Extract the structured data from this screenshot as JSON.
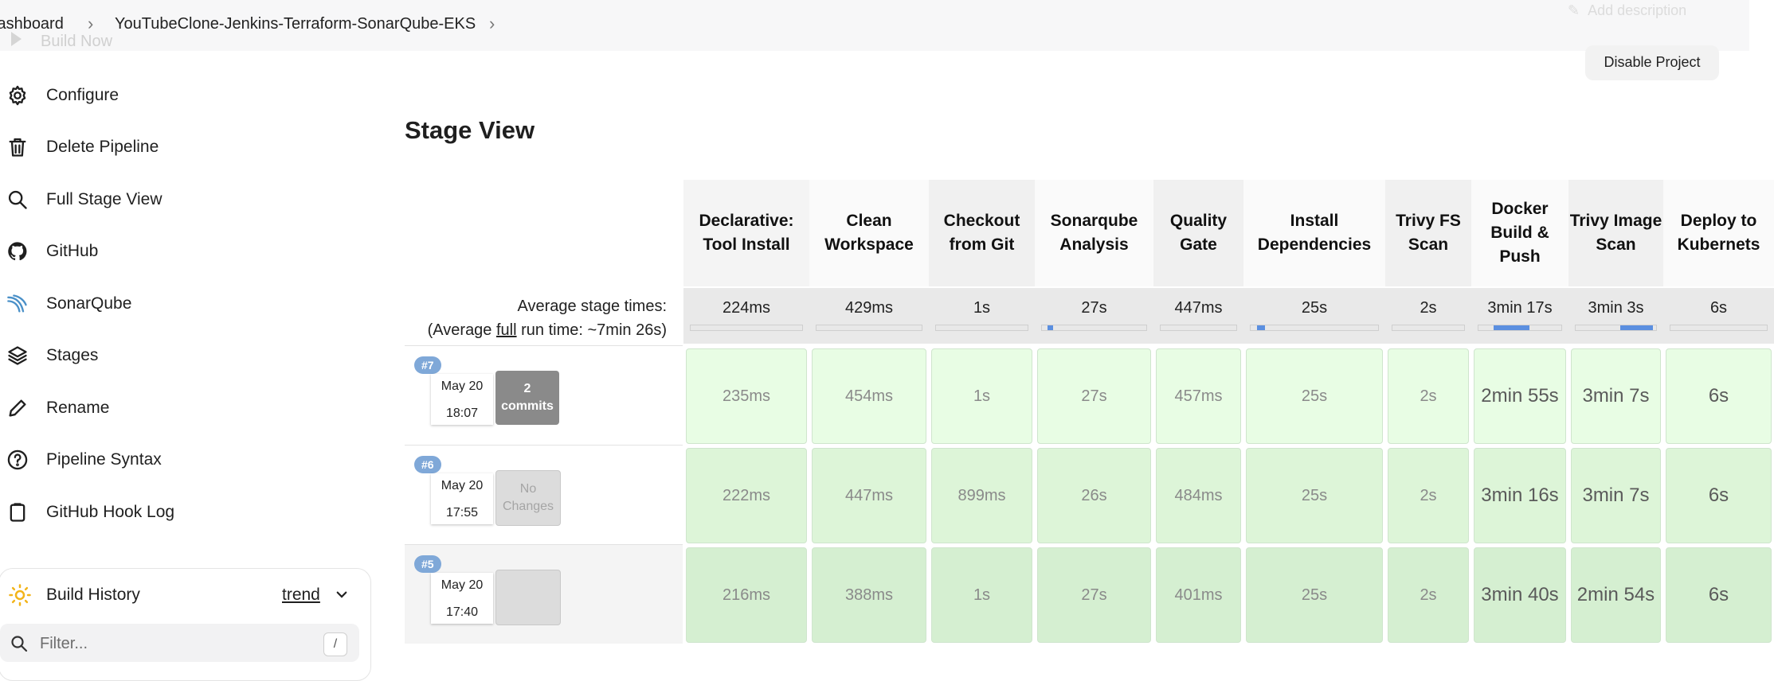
{
  "breadcrumb": [
    "Dashboard",
    "YouTubeClone-Jenkins-Terraform-SonarQube-EKS"
  ],
  "build_now_label": "Build Now",
  "add_description_label": "Add description",
  "disable_project_label": "Disable Project",
  "sidebar": {
    "items": [
      {
        "label": "Configure",
        "icon": "gear-icon"
      },
      {
        "label": "Delete Pipeline",
        "icon": "trash-icon"
      },
      {
        "label": "Full Stage View",
        "icon": "search-icon"
      },
      {
        "label": "GitHub",
        "icon": "github-icon"
      },
      {
        "label": "SonarQube",
        "icon": "sonarqube-icon"
      },
      {
        "label": "Stages",
        "icon": "layers-icon"
      },
      {
        "label": "Rename",
        "icon": "pencil-icon"
      },
      {
        "label": "Pipeline Syntax",
        "icon": "help-circle-icon"
      },
      {
        "label": "GitHub Hook Log",
        "icon": "clipboard-icon"
      }
    ]
  },
  "build_history": {
    "title": "Build History",
    "trend_label": "trend",
    "filter_placeholder": "Filter...",
    "filter_shortcut": "/"
  },
  "stage_view": {
    "title": "Stage View",
    "avg_stage_label": "Average stage times:",
    "avg_run_prefix": "(Average ",
    "avg_run_link": "full",
    "avg_run_suffix": " run time: ~7min 26s)",
    "stages": [
      {
        "name": "Declarative: Tool Install",
        "avg": "224ms",
        "fill": 0.0
      },
      {
        "name": "Clean Workspace",
        "avg": "429ms",
        "fill": 0.0
      },
      {
        "name": "Checkout from Git",
        "avg": "1s",
        "fill": 0.0
      },
      {
        "name": "Sonarqube Analysis",
        "avg": "27s",
        "fill": 0.06
      },
      {
        "name": "Quality Gate",
        "avg": "447ms",
        "fill": 0.0
      },
      {
        "name": "Install Dependencies",
        "avg": "25s",
        "fill": 0.06
      },
      {
        "name": "Trivy FS Scan",
        "avg": "2s",
        "fill": 0.0
      },
      {
        "name": "Docker Build & Push",
        "avg": "3min 17s",
        "fill": 0.44
      },
      {
        "name": "Trivy Image Scan",
        "avg": "3min 3s",
        "fill": 0.41
      },
      {
        "name": "Deploy to Kubernets",
        "avg": "6s",
        "fill": 0.0
      }
    ],
    "builds": [
      {
        "number": "#7",
        "date": "May 20",
        "time": "18:07",
        "changes": "2\ncommits",
        "changes_style": "commits",
        "durations": [
          "235ms",
          "454ms",
          "1s",
          "27s",
          "457ms",
          "25s",
          "2s",
          "2min 55s",
          "3min 7s",
          "6s"
        ]
      },
      {
        "number": "#6",
        "date": "May 20",
        "time": "17:55",
        "changes": "No\nChanges",
        "changes_style": "none",
        "durations": [
          "222ms",
          "447ms",
          "899ms",
          "26s",
          "484ms",
          "25s",
          "2s",
          "3min 16s",
          "3min 7s",
          "6s"
        ]
      },
      {
        "number": "#5",
        "date": "May 20",
        "time": "17:40",
        "changes": "",
        "changes_style": "empty",
        "durations": [
          "216ms",
          "388ms",
          "1s",
          "27s",
          "401ms",
          "25s",
          "2s",
          "3min 40s",
          "2min 54s",
          "6s"
        ]
      }
    ]
  },
  "colors": {
    "cell_light": "#e8fde4",
    "cell_alt": "#ddf5d8",
    "cell_dark": "#d5efd1",
    "accent_blue": "#5b8fe0",
    "badge_blue": "#7fa8d8"
  }
}
